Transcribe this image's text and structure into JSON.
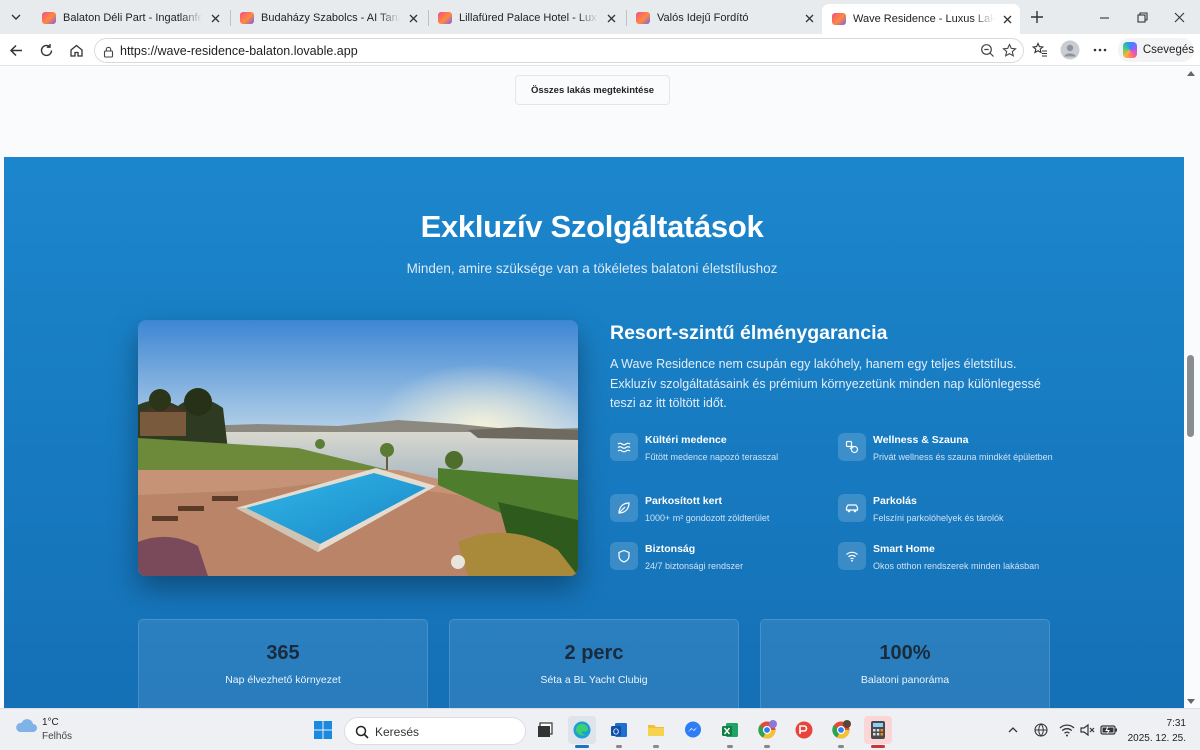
{
  "browser": {
    "tabs": [
      {
        "title": "Balaton Déli Part - Ingatlanfejlesztés",
        "active": false
      },
      {
        "title": "Budaházy Szabolcs - AI Tanácsadó",
        "active": false
      },
      {
        "title": "Lillafüred Palace Hotel - Luxury Hotel",
        "active": false
      },
      {
        "title": "Valós Idejű Fordító",
        "active": false
      },
      {
        "title": "Wave Residence - Luxus Lakások a Balatonon",
        "active": true
      }
    ],
    "url": "https://wave-residence-balaton.lovable.app",
    "copilot_label": "Csevegés"
  },
  "page": {
    "all_apartments_button": "Összes lakás megtekintése",
    "services": {
      "title": "Exkluzív Szolgáltatások",
      "subtitle": "Minden, amire szüksége van a tökéletes balatoni életstílushoz",
      "feature_title": "Resort-szintű élménygarancia",
      "feature_description": "A Wave Residence nem csupán egy lakóhely, hanem egy teljes életstílus. Exkluzív szolgáltatásaink és prémium környezetünk minden nap különlegessé teszi az itt töltött időt.",
      "features": [
        {
          "icon": "waves-icon",
          "title": "Kültéri medence",
          "desc": "Fűtött medence napozó terasszal"
        },
        {
          "icon": "spa-icon",
          "title": "Wellness & Szauna",
          "desc": "Privát wellness és szauna mindkét épületben"
        },
        {
          "icon": "leaf-icon",
          "title": "Parkosított kert",
          "desc": "1000+ m² gondozott zöldterület"
        },
        {
          "icon": "car-icon",
          "title": "Parkolás",
          "desc": "Felszíni parkolóhelyek és tárolók"
        },
        {
          "icon": "shield-icon",
          "title": "Biztonság",
          "desc": "24/7 biztonsági rendszer"
        },
        {
          "icon": "wifi-icon",
          "title": "Smart Home",
          "desc": "Okos otthon rendszerek minden lakásban"
        }
      ],
      "stats": [
        {
          "value": "365",
          "label": "Nap élvezhető környezet"
        },
        {
          "value": "2 perc",
          "label": "Séta a BL Yacht Clubig"
        },
        {
          "value": "100%",
          "label": "Balatoni panoráma"
        }
      ]
    }
  },
  "taskbar": {
    "weather_temp": "1°C",
    "weather_desc": "Felhős",
    "search_placeholder": "Keresés",
    "time": "7:31",
    "date": "2025. 12. 25."
  },
  "colors": {
    "section_blue": "#1c86cc",
    "stat_number": "#1a2b3c"
  }
}
